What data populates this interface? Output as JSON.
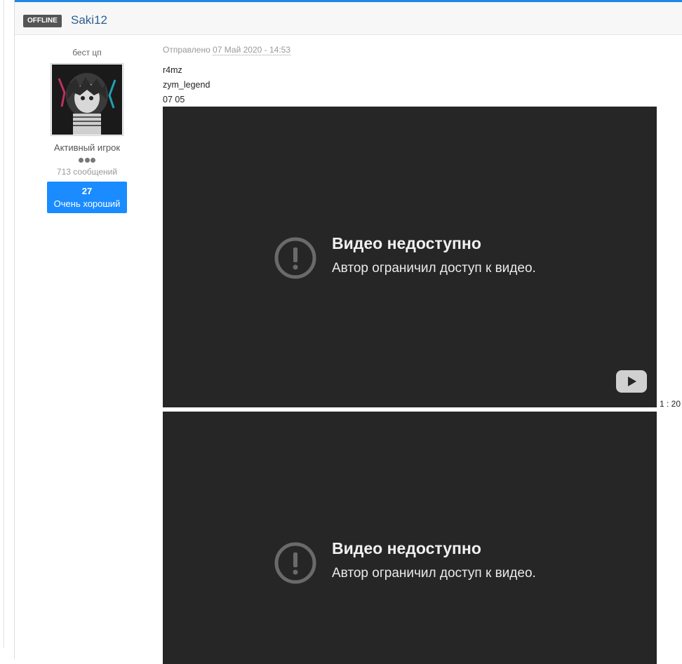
{
  "post": {
    "status_badge": "OFFLINE",
    "username": "Saki12",
    "author": {
      "title": "бест цп",
      "group": "Активный игрок",
      "posts_count": "713 сообщений",
      "reputation_value": "27",
      "reputation_label": "Очень хороший"
    },
    "date_prefix": "Отправлено",
    "date_value": "07 Май 2020 - 14:53",
    "body_lines": [
      "r4mz",
      "zym_legend",
      "07 05"
    ],
    "videos": [
      {
        "title": "Видео недоступно",
        "message": "Автор ограничил доступ к видео."
      },
      {
        "title": "Видео недоступно",
        "message": "Автор ограничил доступ к видео."
      }
    ],
    "side_time": "1 : 20"
  }
}
